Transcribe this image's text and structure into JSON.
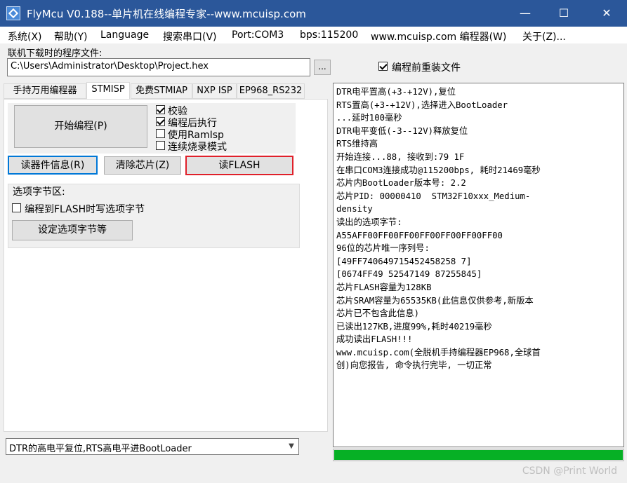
{
  "window": {
    "title": "FlyMcu V0.188--单片机在线编程专家--www.mcuisp.com",
    "minimize": "—",
    "maximize": "☐",
    "close": "✕"
  },
  "menu": {
    "items": [
      "系统(X)",
      "帮助(Y)",
      "Language",
      "搜索串口(V)",
      "Port:COM3",
      "bps:115200",
      "www.mcuisp.com 编程器(W)",
      "关于(Z)..."
    ]
  },
  "file": {
    "label": "联机下载时的程序文件:",
    "path": "C:\\Users\\Administrator\\Desktop\\Project.hex",
    "browse": "...",
    "reload_label": "编程前重装文件",
    "reload_checked": true
  },
  "tabs": [
    {
      "label": "手持万用编程器",
      "active": false
    },
    {
      "label": "STMISP",
      "active": true
    },
    {
      "label": "免费STMIAP",
      "active": false
    },
    {
      "label": "NXP ISP",
      "active": false
    },
    {
      "label": "EP968_RS232",
      "active": false
    }
  ],
  "stmisp": {
    "start_button": "开始编程(P)",
    "options": [
      {
        "label": "校验",
        "checked": true
      },
      {
        "label": "编程后执行",
        "checked": true
      },
      {
        "label": "使用RamIsp",
        "checked": false
      },
      {
        "label": "连续烧录模式",
        "checked": false
      }
    ],
    "read_info_button": "读器件信息(R)",
    "erase_button": "清除芯片(Z)",
    "read_flash_button": "读FLASH",
    "option_bytes_label": "选项字节区:",
    "write_option_label": "编程到FLASH时写选项字节",
    "write_option_checked": false,
    "set_option_button": "设定选项字节等"
  },
  "reset_mode": {
    "selected": "DTR的高电平复位,RTS高电平进BootLoader"
  },
  "log": {
    "lines": [
      "DTR电平置高(+3-+12V),复位",
      "RTS置高(+3-+12V),选择进入BootLoader",
      "...延时100毫秒",
      "DTR电平变低(-3--12V)释放复位",
      "RTS维持高",
      "开始连接...88, 接收到:79 1F",
      "在串口COM3连接成功@115200bps, 耗时21469毫秒",
      "芯片内BootLoader版本号: 2.2",
      "芯片PID: 00000410  STM32F10xxx_Medium-",
      "density",
      "读出的选项字节:",
      "A55AFF00FF00FF00FF00FF00FF00FF00",
      "96位的芯片唯一序列号:",
      "[49FF740649715452458258 7]",
      "[0674FF49 52547149 87255845]",
      "芯片FLASH容量为128KB",
      "芯片SRAM容量为65535KB(此信息仅供参考,新版本",
      "芯片已不包含此信息)",
      "已读出127KB,进度99%,耗时40219毫秒",
      "成功读出FLASH!!!",
      "www.mcuisp.com(全脱机手持编程器EP968,全球首",
      "创)向您报告, 命令执行完毕, 一切正常"
    ]
  },
  "progress": {
    "value": 1.0,
    "color": "#06b025"
  },
  "watermark": "CSDN @Print World"
}
